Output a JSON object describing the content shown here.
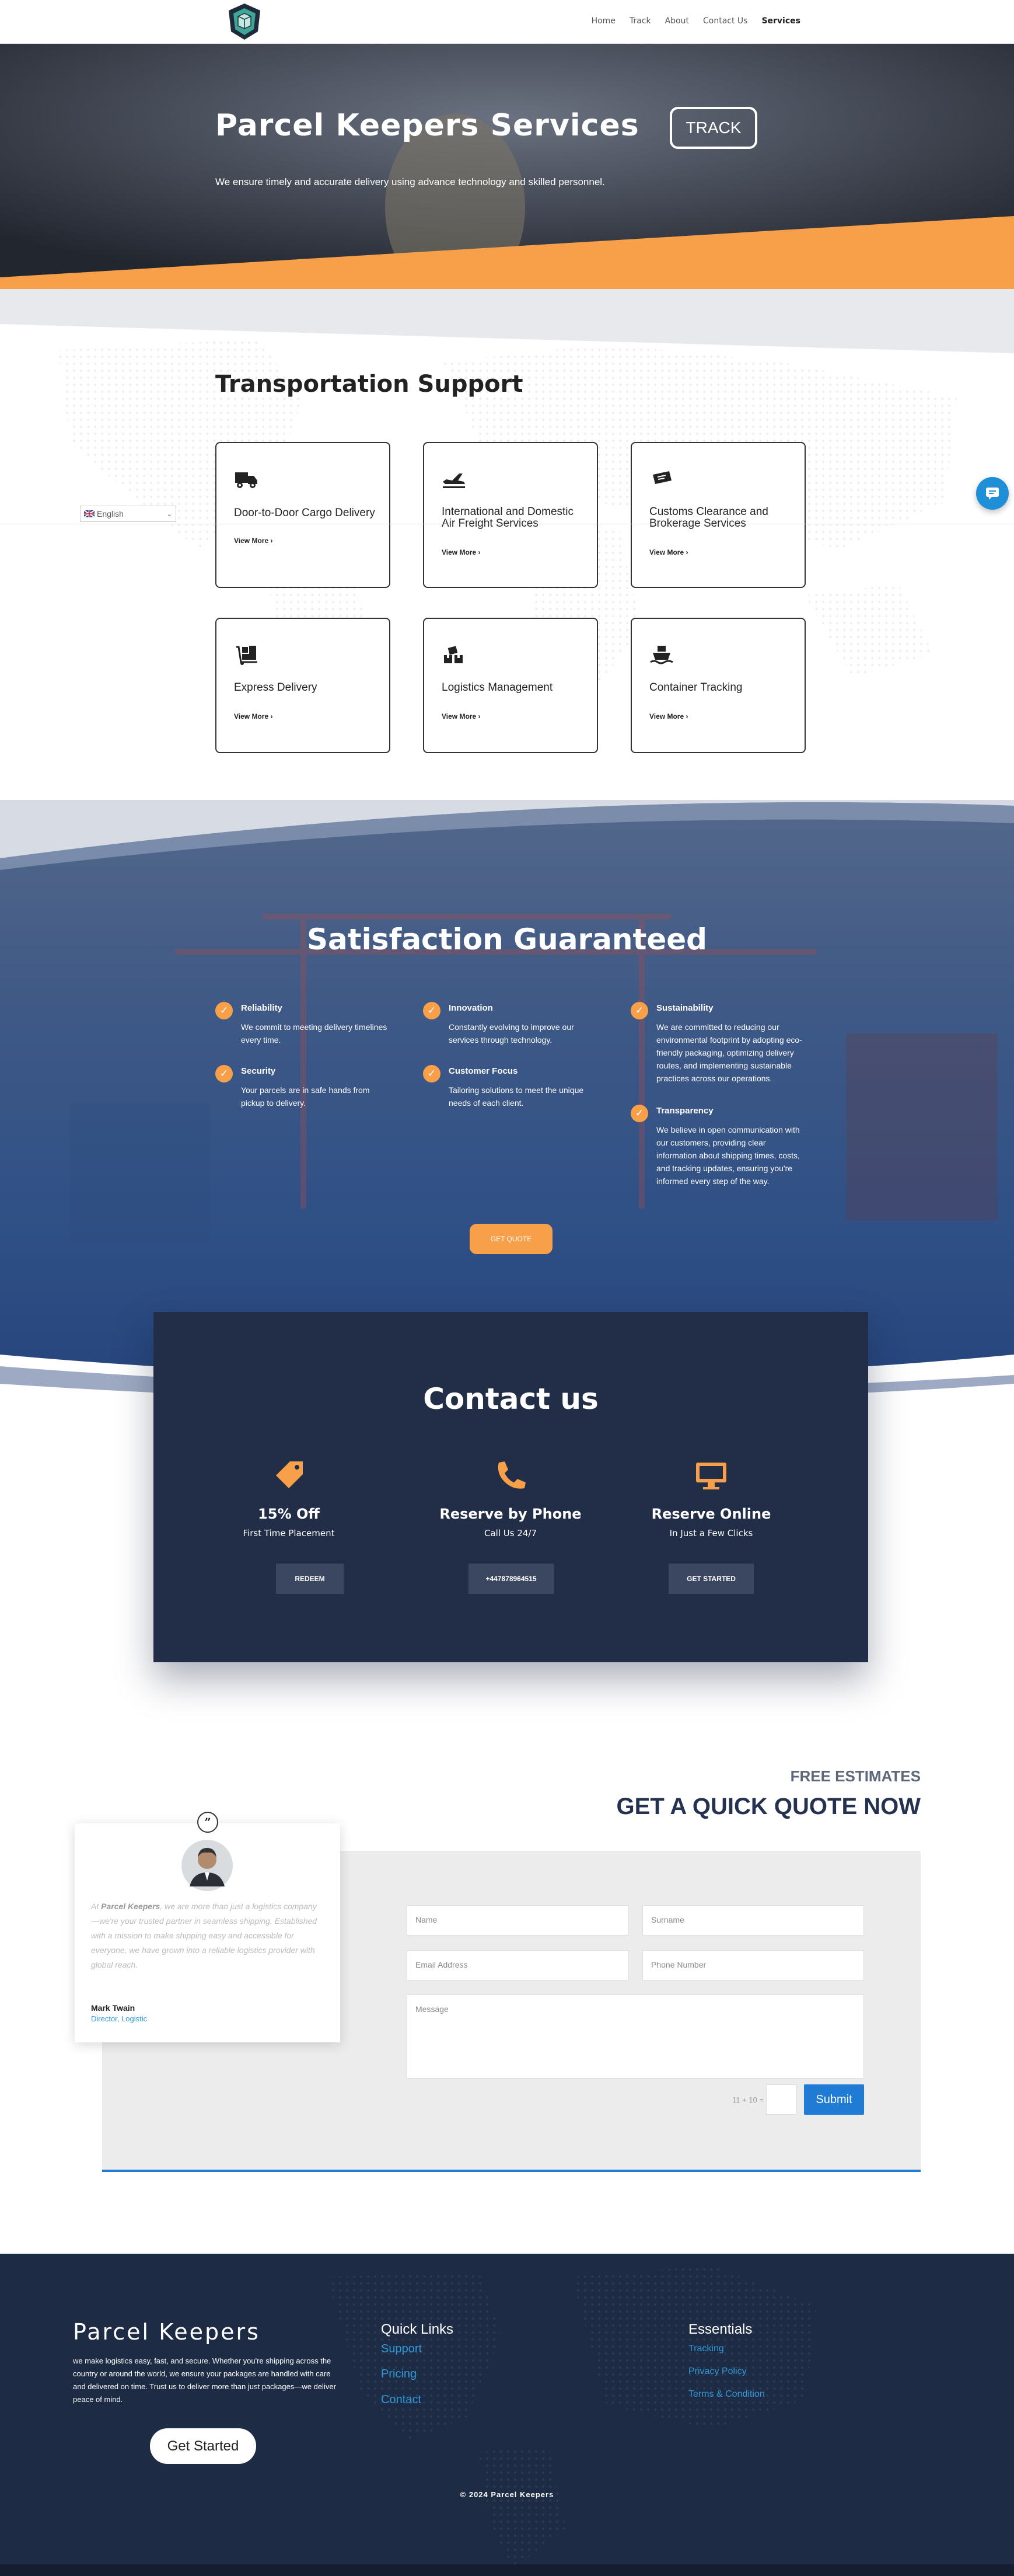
{
  "nav": {
    "items": [
      "Home",
      "Track",
      "About",
      "Contact Us",
      "Services"
    ],
    "active": "Services"
  },
  "hero": {
    "title": "Parcel Keepers Services",
    "subtitle": "We ensure timely and accurate delivery using advance technology and skilled personnel.",
    "track_label": "TRACK"
  },
  "transport": {
    "title": "Transportation Support",
    "cards": [
      {
        "icon": "truck-icon",
        "title": "Door-to-Door Cargo Delivery",
        "link": "View More"
      },
      {
        "icon": "plane-icon",
        "title": "International and Domestic Air Freight Services",
        "link": "View More"
      },
      {
        "icon": "ticket-icon",
        "title": "Customs Clearance and Brokerage Services",
        "link": "View More"
      },
      {
        "icon": "dolly-icon",
        "title": "Express Delivery",
        "link": "View More"
      },
      {
        "icon": "boxes-icon",
        "title": "Logistics Management",
        "link": "View More"
      },
      {
        "icon": "ship-icon",
        "title": "Container Tracking",
        "link": "View More"
      }
    ]
  },
  "language": {
    "value": "English"
  },
  "satisfaction": {
    "title": "Satisfaction Guaranteed",
    "features": [
      {
        "title": "Reliability",
        "text": "We commit to meeting delivery timelines every time."
      },
      {
        "title": "Security",
        "text": "Your parcels are in safe hands from pickup to delivery."
      },
      {
        "title": "Innovation",
        "text": "Constantly evolving to improve our services through technology."
      },
      {
        "title": "Customer Focus",
        "text": "Tailoring solutions to meet the unique needs of each client."
      },
      {
        "title": "Sustainability",
        "text": "We are committed to reducing our environmental footprint by adopting eco-friendly packaging, optimizing delivery routes, and implementing sustainable practices across our operations."
      },
      {
        "title": "Transparency",
        "text": "We believe in open communication with our customers, providing clear information about shipping times, costs, and tracking updates, ensuring you're informed every step of the way."
      }
    ],
    "button": "GET QUOTE"
  },
  "contact": {
    "title": "Contact us",
    "items": [
      {
        "icon": "tag-icon",
        "title": "15% Off",
        "sub": "First Time Placement",
        "button": "REDEEM"
      },
      {
        "icon": "phone-icon",
        "title": "Reserve by Phone",
        "sub": "Call Us 24/7",
        "button": "+447878964515"
      },
      {
        "icon": "monitor-icon",
        "title": "Reserve Online",
        "sub": "In Just a Few Clicks",
        "button": "GET STARTED"
      }
    ]
  },
  "quote": {
    "eyebrow": "FREE ESTIMATES",
    "title": "GET A QUICK QUOTE NOW",
    "fields": {
      "name": "Name",
      "surname": "Surname",
      "email": "Email Address",
      "phone": "Phone Number",
      "message": "Message"
    },
    "captcha": "11 + 10 =",
    "submit": "Submit"
  },
  "testimonial": {
    "text_prefix": "At ",
    "brand": "Parcel Keepers",
    "text": ", we are more than just a logistics company—we're your trusted partner in seamless shipping. Established with a mission to make shipping easy and accessible for everyone, we have grown into a reliable logistics provider with global reach.",
    "name": "Mark Twain",
    "role": "Director, Logistic"
  },
  "footer": {
    "brand": "Parcel Keepers",
    "about": "we make logistics easy, fast, and secure. Whether you're shipping across the country or around the world, we ensure your packages are handled with care and delivered on time. Trust us to deliver more than just packages—we deliver peace of mind.",
    "cta": "Get Started",
    "quick_title": "Quick Links",
    "quick_links": [
      "Support",
      "Pricing",
      "Contact"
    ],
    "ess_title": "Essentials",
    "ess_links": [
      "Tracking",
      "Privacy Policy",
      "Terms & Condition"
    ],
    "copyright": "© 2024 Parcel Keepers"
  },
  "colors": {
    "accent": "#f7a049",
    "navy": "#222d47",
    "link": "#2e9ad8",
    "submit": "#1f7bd3"
  }
}
